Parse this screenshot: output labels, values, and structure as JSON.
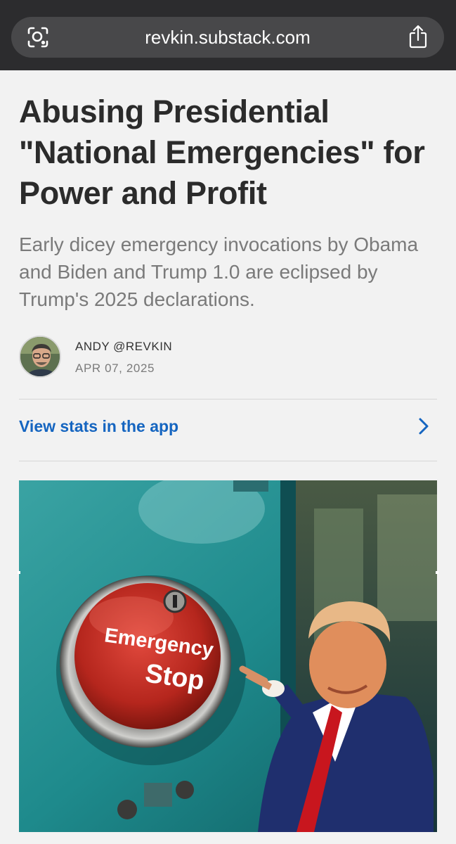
{
  "browser": {
    "url": "revkin.substack.com",
    "left_icon": "visual-lookup-icon",
    "right_icon": "share-icon"
  },
  "article": {
    "title": "Abusing Presidential \"National Emergencies\" for Power and Profit",
    "subtitle": "Early dicey emergency invocations by Obama and Biden and Trump 1.0 are eclipsed by Trump's 2025 declarations.",
    "author": "ANDY @REVKIN",
    "date": "APR 07, 2025"
  },
  "stats": {
    "label": "View stats in the app",
    "icon": "chevron-right-icon"
  },
  "hero_image": {
    "button_line1": "Emergency",
    "button_line2": "Stop"
  },
  "colors": {
    "link": "#1565c0",
    "browser_bar": "#2c2c2e",
    "page_bg": "#f2f2f2"
  }
}
